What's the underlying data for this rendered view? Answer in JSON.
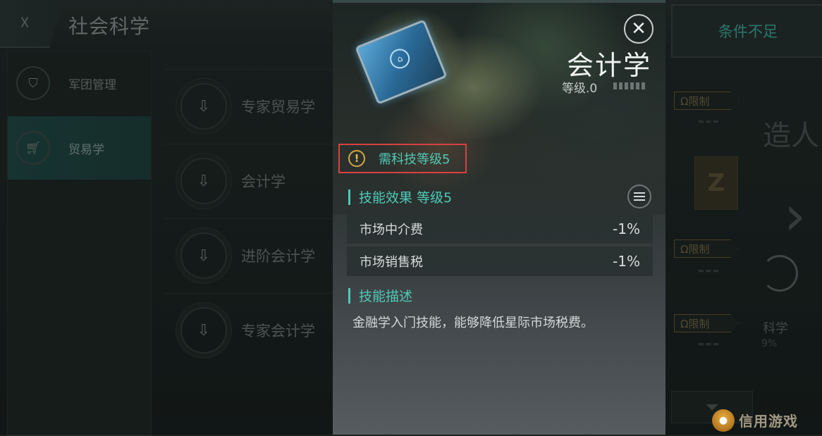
{
  "header": {
    "title": "社会科学",
    "condition_button": "条件不足"
  },
  "sidebar": {
    "items": [
      {
        "label": "军团管理",
        "icon": "person-badge-icon"
      },
      {
        "label": "贸易学",
        "icon": "cart-icon",
        "active": true
      }
    ]
  },
  "skill_list": [
    {
      "label": "专家贸易学"
    },
    {
      "label": "会计学"
    },
    {
      "label": "进阶会计学"
    },
    {
      "label": "专家会计学"
    }
  ],
  "right_panel": {
    "limit_tags": [
      "Ω限制",
      "Ω限制",
      "Ω限制"
    ],
    "badge_letter": "Z",
    "big_text": "造人",
    "science_text": "科学",
    "percent_text": "9%"
  },
  "modal": {
    "skill_name": "会计学",
    "level_label": "等级.0",
    "level_segments_total": 6,
    "requirement": "需科技等级5",
    "effect_heading": "技能效果 等级5",
    "effects": [
      {
        "name": "市场中介费",
        "value": "-1%"
      },
      {
        "name": "市场销售税",
        "value": "-1%"
      }
    ],
    "description_heading": "技能描述",
    "description": "金融学入门技能，能够降低星际市场税费。"
  },
  "watermark": {
    "text": "信用游戏"
  },
  "colors": {
    "accent": "#4fc9b6",
    "warning": "#d6a640",
    "highlight_box": "#d8413f",
    "limit_gold": "#6b5a32"
  }
}
